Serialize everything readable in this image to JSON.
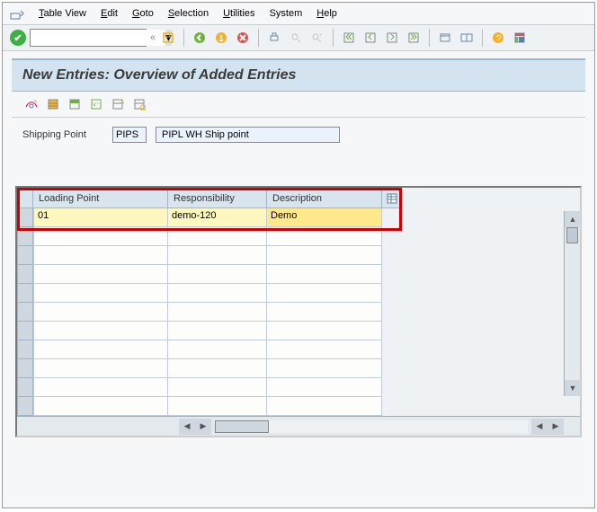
{
  "menu": {
    "table_view": "Table View",
    "edit": "Edit",
    "goto": "Goto",
    "selection": "Selection",
    "utilities": "Utilities",
    "system": "System",
    "help": "Help"
  },
  "title": "New Entries: Overview of Added Entries",
  "field": {
    "label": "Shipping Point",
    "code": "PIPS",
    "desc": "PIPL WH Ship point"
  },
  "columns": {
    "loading_point": "Loading Point",
    "responsibility": "Responsibility",
    "description": "Description"
  },
  "rows": [
    {
      "loading_point": "01",
      "responsibility": "demo-120",
      "description": "Demo"
    },
    {
      "loading_point": "",
      "responsibility": "",
      "description": ""
    },
    {
      "loading_point": "",
      "responsibility": "",
      "description": ""
    },
    {
      "loading_point": "",
      "responsibility": "",
      "description": ""
    },
    {
      "loading_point": "",
      "responsibility": "",
      "description": ""
    },
    {
      "loading_point": "",
      "responsibility": "",
      "description": ""
    },
    {
      "loading_point": "",
      "responsibility": "",
      "description": ""
    },
    {
      "loading_point": "",
      "responsibility": "",
      "description": ""
    },
    {
      "loading_point": "",
      "responsibility": "",
      "description": ""
    },
    {
      "loading_point": "",
      "responsibility": "",
      "description": ""
    },
    {
      "loading_point": "",
      "responsibility": "",
      "description": ""
    }
  ]
}
